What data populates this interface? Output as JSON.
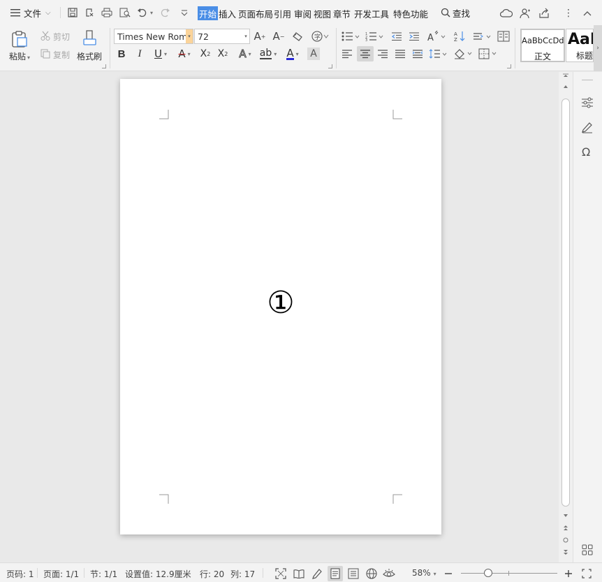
{
  "menubar": {
    "file_label": "文件",
    "tabs": [
      "开始",
      "插入",
      "页面布局",
      "引用",
      "审阅",
      "视图",
      "章节",
      "开发工具",
      "特色功能"
    ],
    "active_tab": "开始",
    "search_label": "查找"
  },
  "ribbon": {
    "paste_label": "粘贴",
    "cut_label": "剪切",
    "copy_label": "复制",
    "format_painter_label": "格式刷",
    "font_name": "Times New Roman",
    "font_size": "72",
    "styles": [
      {
        "sample": "AaBbCcDd",
        "label": "正文"
      },
      {
        "sample": "AaI",
        "label": "标题"
      }
    ]
  },
  "document": {
    "content": "①"
  },
  "statusbar": {
    "page_code": "页码: 1",
    "pages": "页面: 1/1",
    "section": "节: 1/1",
    "setting_value": "设置值: 12.9厘米",
    "row": "行: 20",
    "col": "列: 17",
    "zoom": "58%",
    "zoom_level": 0.58
  },
  "colors": {
    "accent": "#4a8ee6",
    "font_color_underline": "#2b2bd6",
    "highlight_box": "#dcdcdc"
  }
}
